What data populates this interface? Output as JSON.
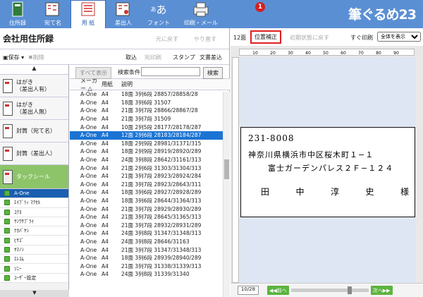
{
  "toolbar": {
    "items": [
      {
        "label": "住所録",
        "icon": "address-book-icon"
      },
      {
        "label": "宛て名",
        "icon": "recipient-icon"
      },
      {
        "label": "用 紙",
        "icon": "paper-icon"
      },
      {
        "label": "差出人",
        "icon": "sender-icon"
      },
      {
        "label": "フォント",
        "icon": "font-icon"
      },
      {
        "label": "印刷・メール",
        "icon": "printer-icon"
      }
    ],
    "brand": "筆ぐるめ23",
    "font_glyph": "あ",
    "font_glyph_small": "あ"
  },
  "left": {
    "title": "会社用住所録",
    "undo": "元に戻す",
    "redo": "やり直す",
    "save": "保存",
    "delete": "削除",
    "actions": [
      "取込",
      "宛印刷",
      "スタンプ",
      "文書差込"
    ]
  },
  "categories": [
    {
      "label": "はがき\n（差出人有）"
    },
    {
      "label": "はがき\n（差出人無）"
    },
    {
      "label": "封筒（宛て名）"
    },
    {
      "label": "封筒（差出人）"
    },
    {
      "label": "タックシール"
    }
  ],
  "makers": [
    "A-One",
    "ｴｲﾌﾞﾘｨ ﾏｸｾﾙ",
    "ｺｸﾖ",
    "ｻﾝﾜｻﾌﾟﾗｲ",
    "ﾅｶﾊﾞﾔｼ",
    "ﾋｻｺﾞ",
    "ﾔﾏﾉﾝ",
    "ｴﾚｺﾑ",
    "ｿﾆｰ",
    "ﾕｰｻﾞｰ設定"
  ],
  "list": {
    "show_all": "すべて表示",
    "search_label": "検索条件",
    "search_value": "",
    "search_button": "検索",
    "headers": [
      "メーカー △",
      "用紙",
      "説明"
    ],
    "rows": [
      [
        "A-One",
        "A4",
        "18面 3列6段 28857/28858/28"
      ],
      [
        "A-One",
        "A4",
        "18面 3列6段 31507"
      ],
      [
        "A-One",
        "A4",
        "21面 3列7段 28866/28867/28"
      ],
      [
        "A-One",
        "A4",
        "21面 3列7段 31509"
      ],
      [
        "A-One",
        "A4",
        "10面 2列5段 28177/28178/287"
      ],
      [
        "A-One",
        "A4",
        "12面 2列6段 28183/28184/287"
      ],
      [
        "A-One",
        "A4",
        "18面 2列9段 28981/31371/315"
      ],
      [
        "A-One",
        "A4",
        "18面 2列9段 28919/28920/289"
      ],
      [
        "A-One",
        "A4",
        "24面 3列8段 28642/31161/313"
      ],
      [
        "A-One",
        "A4",
        "21面 2列6段 31303/31304/313"
      ],
      [
        "A-One",
        "A4",
        "21面 3列7段 28923/28924/284"
      ],
      [
        "A-One",
        "A4",
        "21面 3列7段 28923/28643/311"
      ],
      [
        "A-One",
        "A4",
        "18面 3列6段 28927/28928/289"
      ],
      [
        "A-One",
        "A4",
        "18面 3列6段 28644/31364/313"
      ],
      [
        "A-One",
        "A4",
        "21面 3列7段 28929/28930/289"
      ],
      [
        "A-One",
        "A4",
        "21面 3列7段 28645/31365/313"
      ],
      [
        "A-One",
        "A4",
        "21面 3列7段 28932/28931/289"
      ],
      [
        "A-One",
        "A4",
        "24面 3列8段 31347/31348/313"
      ],
      [
        "A-One",
        "A4",
        "24面 3列8段 28646/31163"
      ],
      [
        "A-One",
        "A4",
        "21面 3列7段 31347/31348/313"
      ],
      [
        "A-One",
        "A4",
        "18面 3列6段 28939/28940/289"
      ],
      [
        "A-One",
        "A4",
        "21面 3列7段 31338/31339/313"
      ],
      [
        "A-One",
        "A4",
        "24面 3列8段 31339/31340"
      ]
    ]
  },
  "right": {
    "faces": "12面",
    "position_button": "位置補正",
    "reset": "初期状態に戻す",
    "print_now": "すぐ印刷",
    "view_select": "全体を表示",
    "badge": "1",
    "page": "10/28",
    "prev": "前へ",
    "next": "次へ",
    "ruler_labels": [
      "10",
      "20",
      "30",
      "40",
      "50",
      "60",
      "70",
      "80",
      "90"
    ],
    "address": {
      "zip": "231-8008",
      "line1": "神奈川県横浜市中区桜木町１−１",
      "line2": "富士ガーデンパレス２Ｆ−１２４",
      "name": [
        "田",
        "中",
        "淳",
        "史",
        "様"
      ]
    }
  }
}
